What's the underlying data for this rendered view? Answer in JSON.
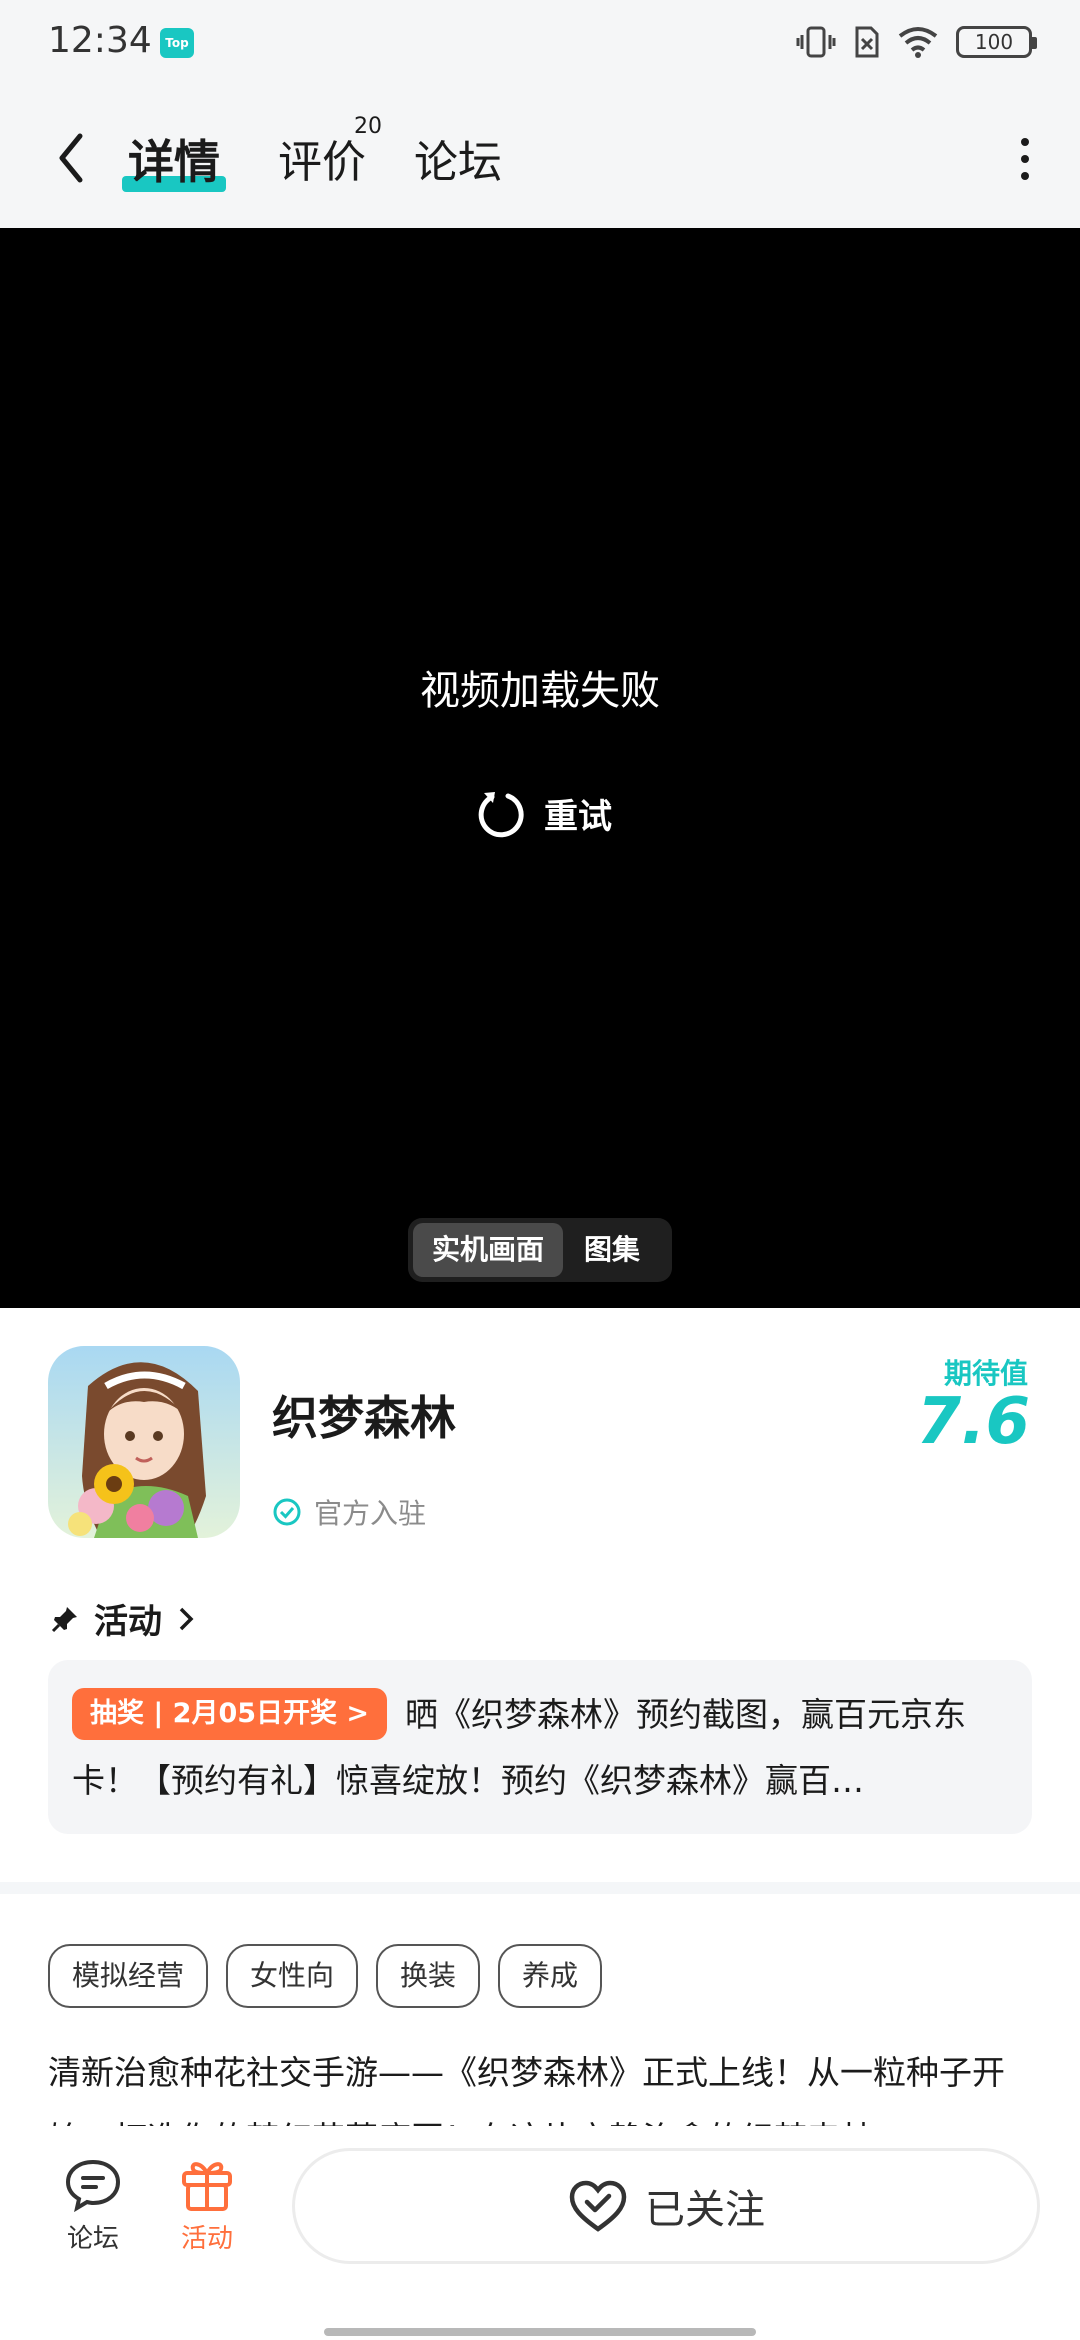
{
  "status_bar": {
    "time": "12:34",
    "app_badge": "Top",
    "battery": "100"
  },
  "top_nav": {
    "tabs": [
      {
        "label": "详情"
      },
      {
        "label": "评价",
        "count": "20"
      },
      {
        "label": "论坛"
      }
    ]
  },
  "video": {
    "error_text": "视频加载失败",
    "retry_label": "重试",
    "media_options": [
      "实机画面",
      "图集"
    ]
  },
  "game": {
    "name": "织梦森林",
    "official_label": "官方入驻",
    "expect_label": "期待值",
    "expect_score": "7.6"
  },
  "activity": {
    "header": "活动",
    "badge": "抽奖 | 2月05日开奖 >",
    "text": "晒《织梦森林》预约截图，赢百元京东卡！【预约有礼】惊喜绽放！预约《织梦森林》赢百…"
  },
  "tags": [
    "模拟经营",
    "女性向",
    "换装",
    "养成"
  ],
  "description": "清新治愈种花社交手游——《织梦森林》正式上线！从一粒种子开始，打造你的梦幻花草庭园！在这片宁静治愈的织梦森林",
  "bottom_bar": {
    "forum_label": "论坛",
    "activity_label": "活动",
    "follow_label": "已关注"
  },
  "colors": {
    "accent": "#19c7c2",
    "orange": "#ff6f3c"
  }
}
